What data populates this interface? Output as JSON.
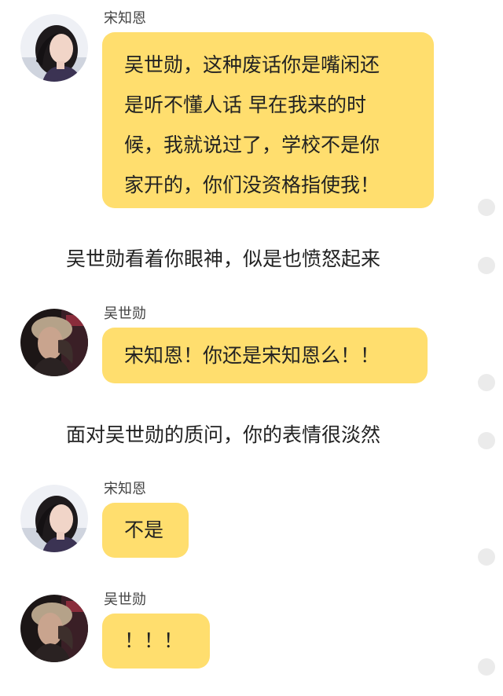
{
  "messages": [
    {
      "sender": "宋知恩",
      "lines": [
        "吴世勋，这种废话你是嘴闲还",
        "是听不懂人话  早在我来的时",
        "候，我就说过了，学校不是你",
        "家开的，你们没资格指使我！"
      ]
    },
    {
      "narration": "吴世勋看着你眼神，似是也愤怒起来"
    },
    {
      "sender": "吴世勋",
      "lines": [
        "宋知恩！你还是宋知恩么！！"
      ]
    },
    {
      "narration": "面对吴世勋的质问，你的表情很淡然"
    },
    {
      "sender": "宋知恩",
      "lines": [
        "不是"
      ]
    },
    {
      "sender": "吴世勋",
      "lines": [
        "！！！"
      ]
    }
  ],
  "avatars": {
    "female": "female-avatar-photo",
    "male": "male-avatar-photo"
  },
  "colors": {
    "bubble": "#FFDE6E",
    "text": "#222222",
    "sender": "#444444",
    "scroll_dot": "#ebebeb"
  }
}
